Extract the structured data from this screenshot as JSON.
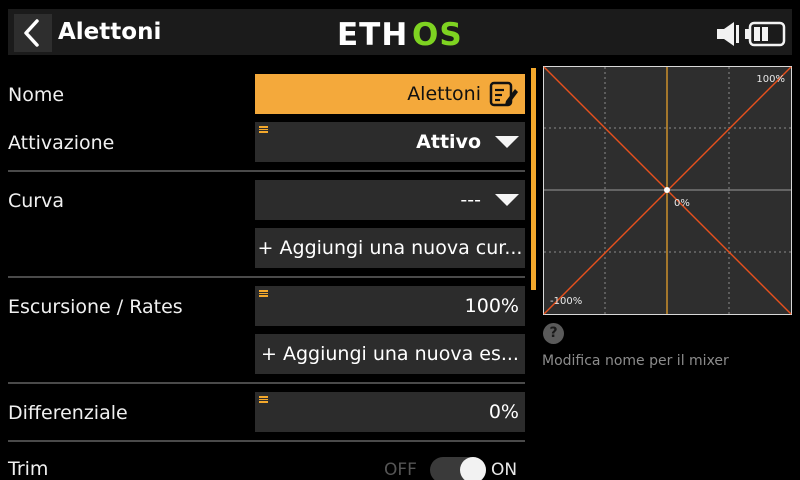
{
  "header": {
    "title": "Alettoni",
    "logo_text": "ETHOS",
    "icons": [
      "back-arrow-icon",
      "speaker-icon",
      "battery-icon"
    ]
  },
  "form": {
    "nome": {
      "label": "Nome",
      "value": "Alettoni",
      "icon": "edit-icon"
    },
    "attivazione": {
      "label": "Attivazione",
      "value": "Attivo"
    },
    "curva": {
      "label": "Curva",
      "value": "---",
      "add_label": "+ Aggiungi una nuova cur..."
    },
    "escursione": {
      "label": "Escursione / Rates",
      "value": "100%",
      "add_label": "+ Aggiungi una nuova es..."
    },
    "differenziale": {
      "label": "Differenziale",
      "value": "0%"
    },
    "trim": {
      "label": "Trim",
      "off_label": "OFF",
      "on_label": "ON",
      "state": "on"
    }
  },
  "graph": {
    "top_right_label": "100%",
    "center_label": "0%",
    "bottom_left_label": "-100%"
  },
  "help": {
    "icon": "question-icon",
    "text": "Modifica nome per il mixer"
  },
  "colors": {
    "accent": "#f4a93b",
    "curve": "#e8501c",
    "logo_green": "#7ed321"
  }
}
